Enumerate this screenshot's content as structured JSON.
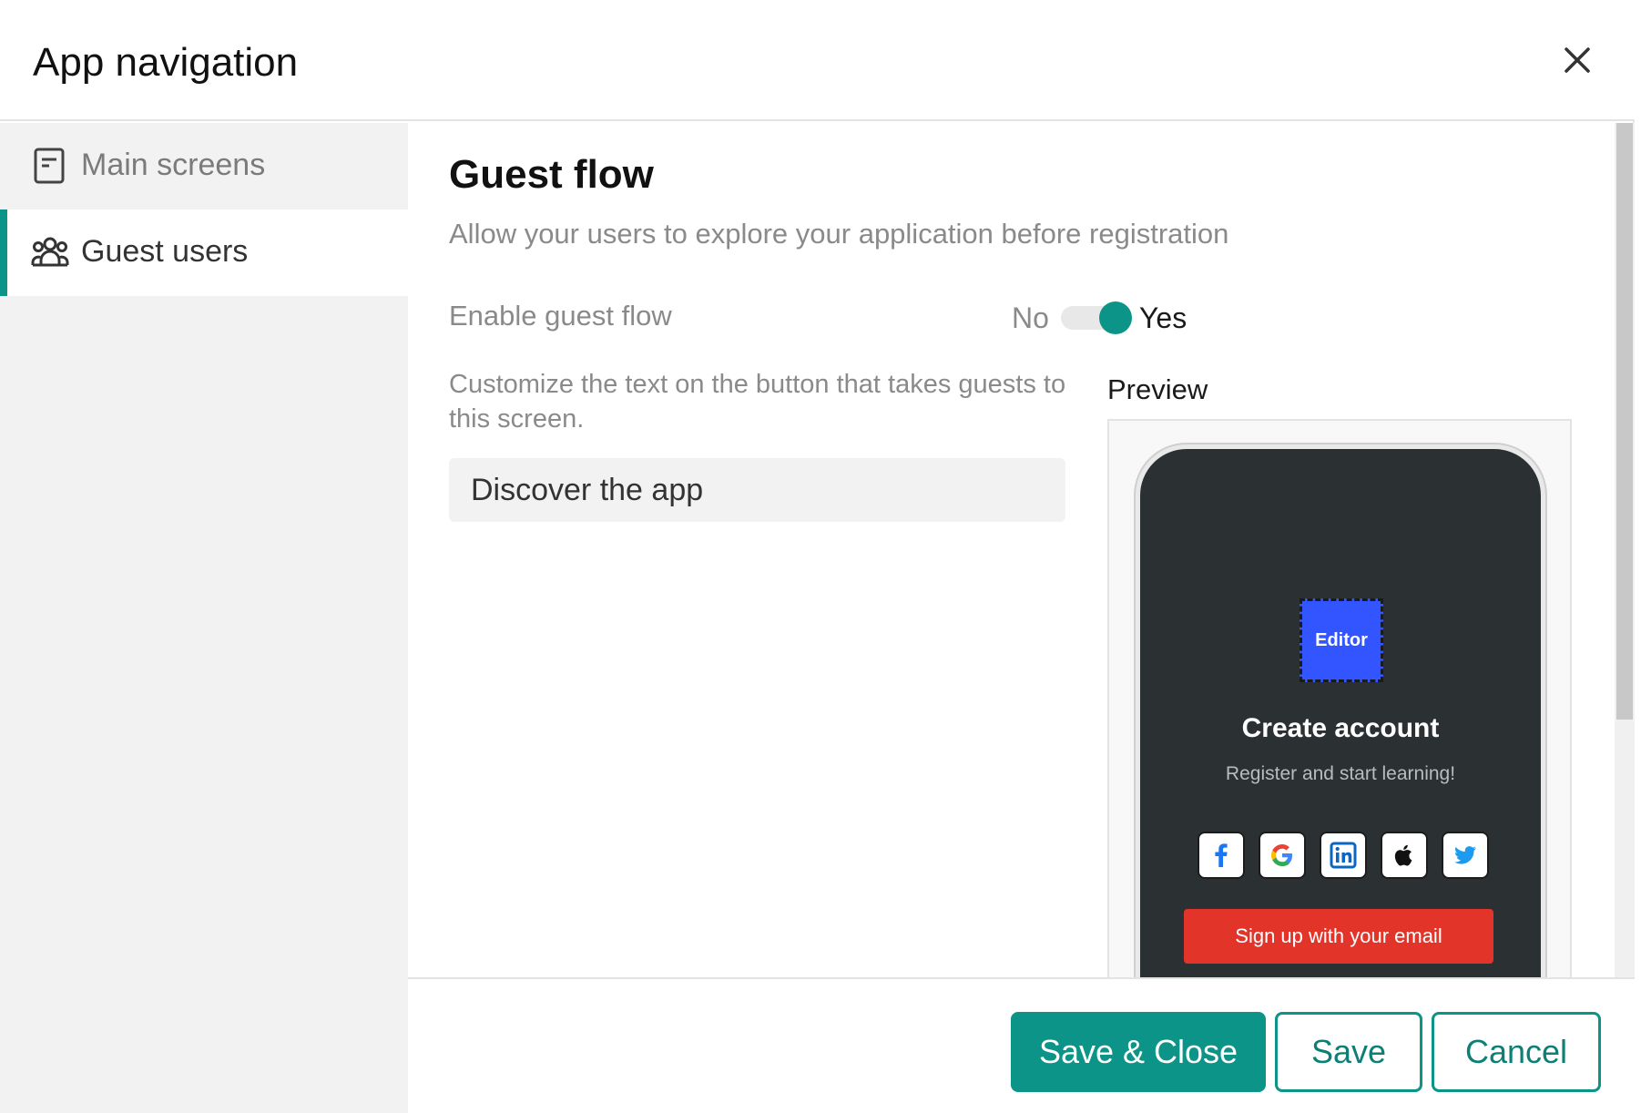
{
  "header": {
    "title": "App navigation"
  },
  "sidebar": {
    "items": [
      {
        "label": "Main screens",
        "icon": "document-icon",
        "active": false
      },
      {
        "label": "Guest users",
        "icon": "users-group-icon",
        "active": true
      }
    ]
  },
  "content": {
    "title": "Guest flow",
    "subtitle": "Allow your users to explore your application before registration",
    "enable_label": "Enable guest flow",
    "toggle": {
      "off_label": "No",
      "on_label": "Yes",
      "value": true
    },
    "customize_text": "Customize the text on the button that takes guests to this screen.",
    "button_text_value": "Discover the app",
    "preview_label": "Preview"
  },
  "preview": {
    "logo_text": "Editor",
    "title": "Create account",
    "subtitle": "Register and start learning!",
    "social": [
      "facebook-icon",
      "google-icon",
      "linkedin-icon",
      "apple-icon",
      "twitter-icon"
    ],
    "signup_label": "Sign up with your email"
  },
  "footer": {
    "save_close_label": "Save & Close",
    "save_label": "Save",
    "cancel_label": "Cancel"
  },
  "colors": {
    "accent": "#0d9488",
    "signup": "#e3342a",
    "logo": "#3355ff",
    "phone_bg": "#2b3132"
  }
}
